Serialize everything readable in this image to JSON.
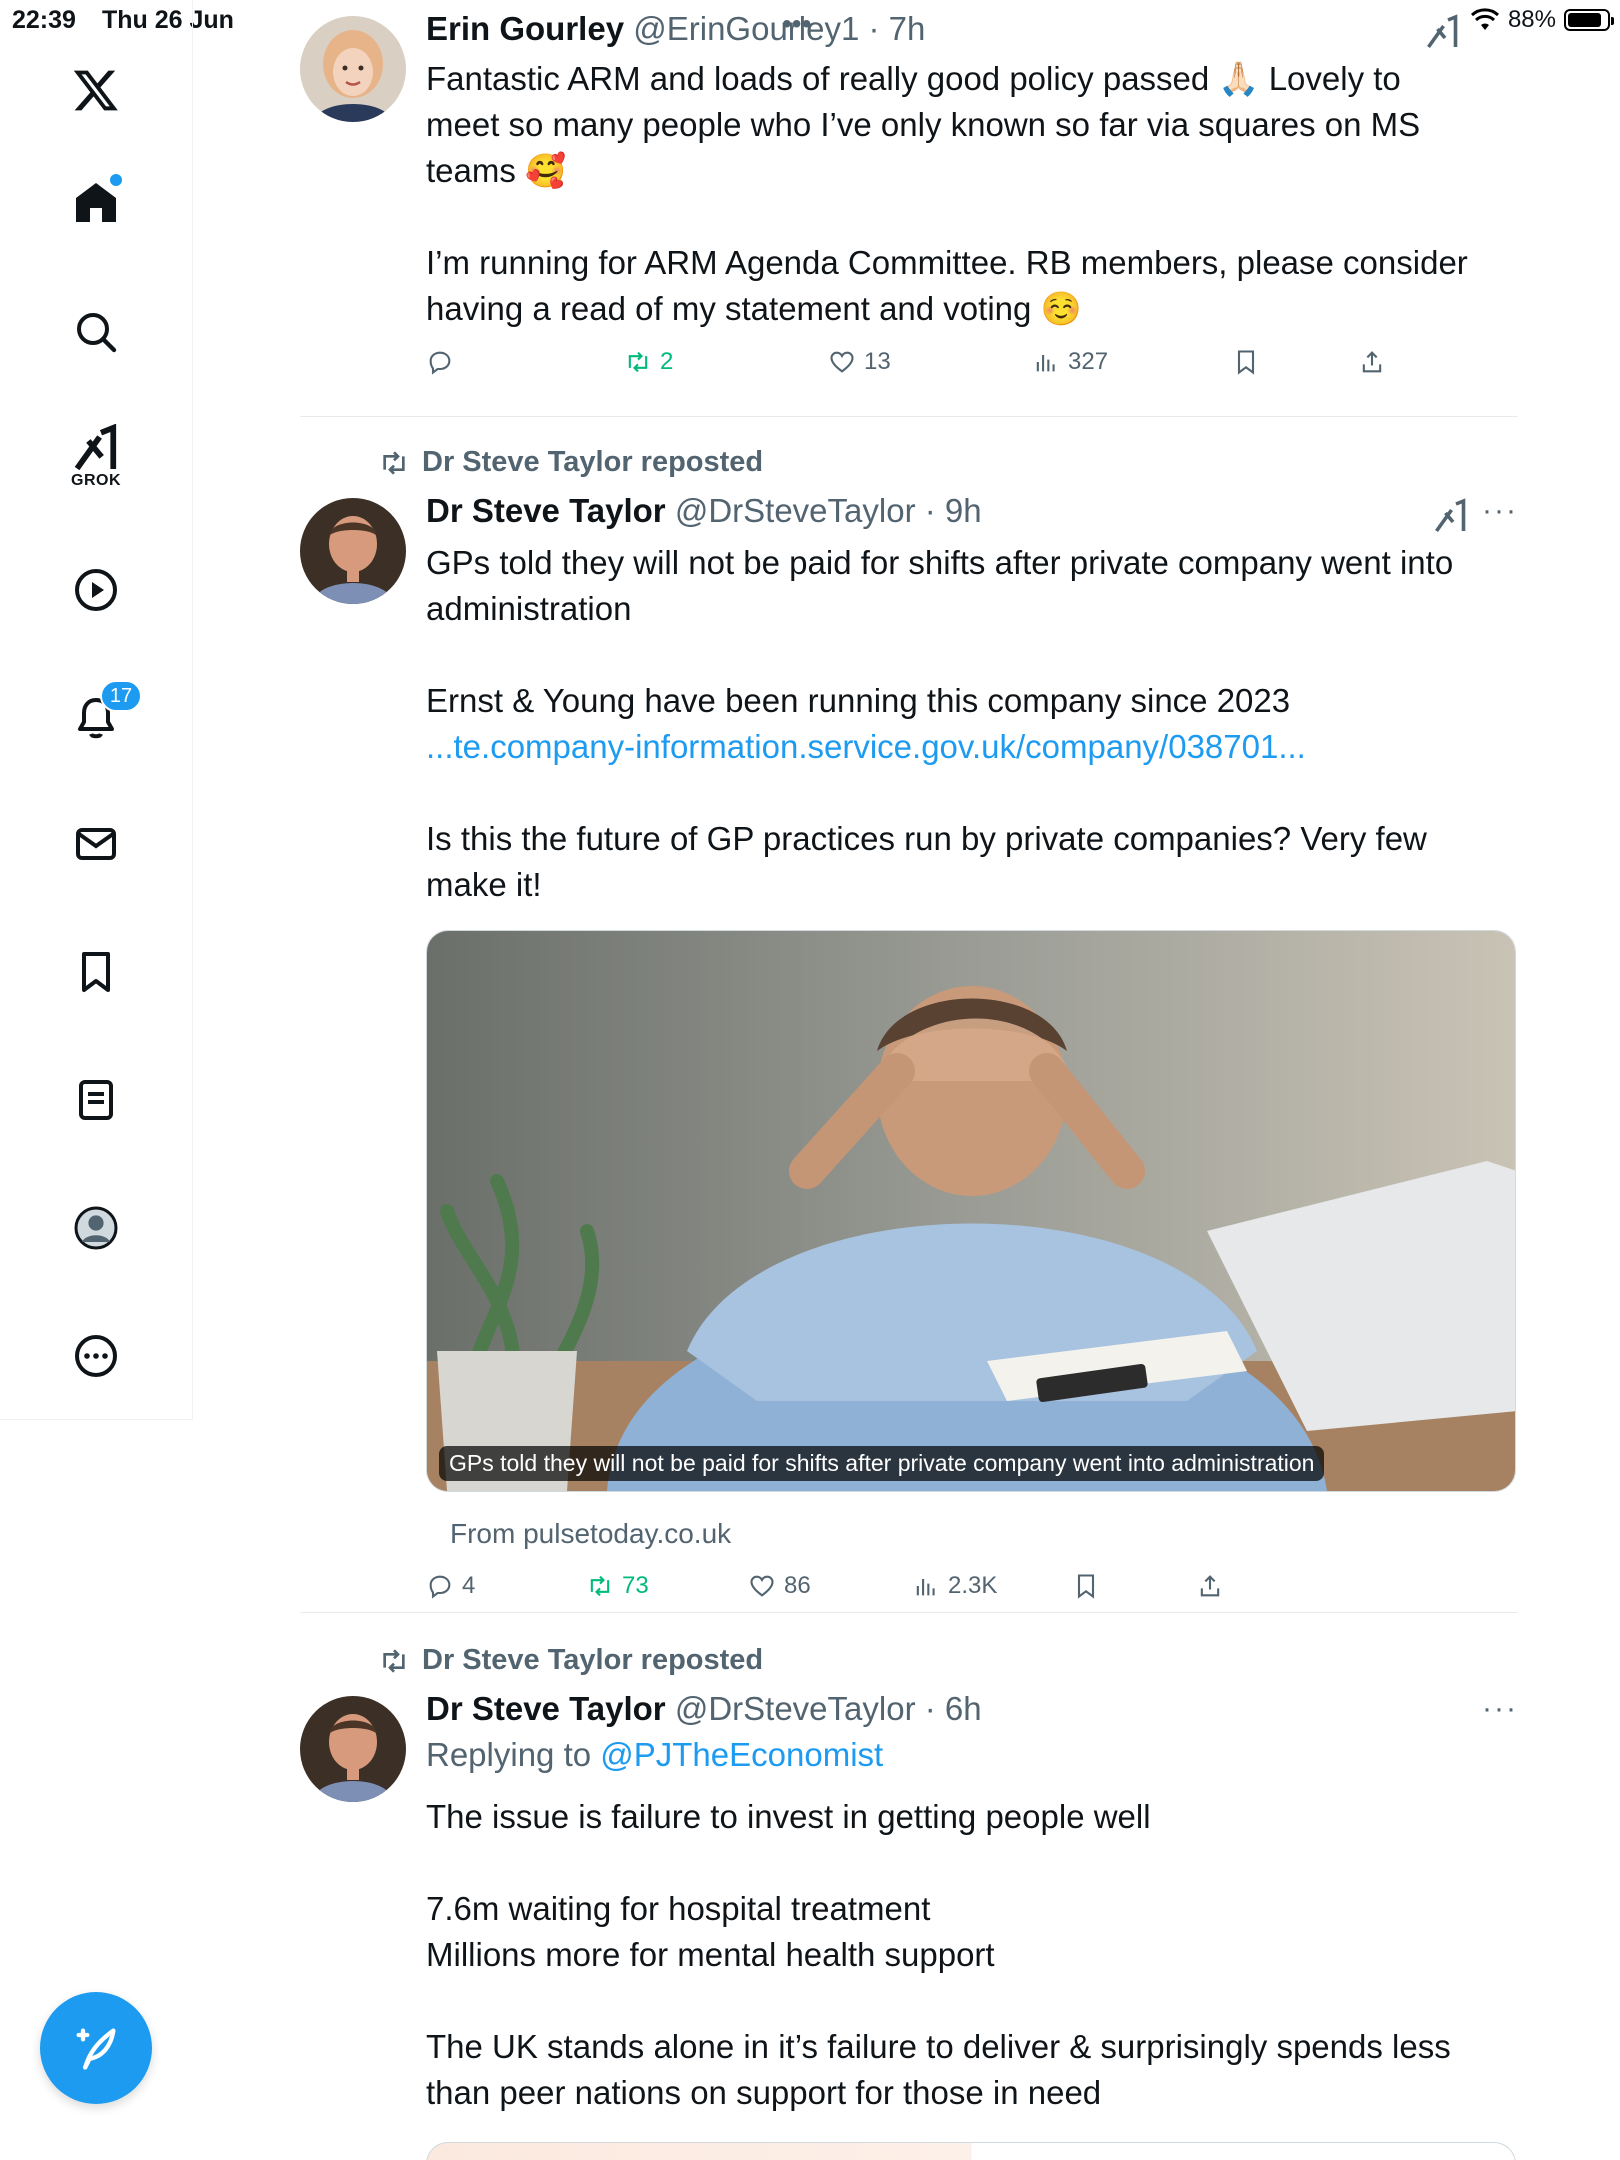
{
  "status_bar": {
    "time": "22:39",
    "date": "Thu 26 Jun",
    "battery": "88%",
    "battery_level": 0.88,
    "top_dots": "•••"
  },
  "sidebar": {
    "items": [
      {
        "name": "x-logo-icon"
      },
      {
        "name": "home-icon"
      },
      {
        "name": "search-icon"
      },
      {
        "name": "grok-icon",
        "label": "GROK"
      },
      {
        "name": "video-icon"
      },
      {
        "name": "notifications-icon",
        "badge": "17"
      },
      {
        "name": "messages-icon"
      },
      {
        "name": "bookmarks-icon"
      },
      {
        "name": "lists-icon"
      },
      {
        "name": "profile-icon"
      },
      {
        "name": "more-icon"
      }
    ],
    "compose_icon": "compose-icon"
  },
  "posts": [
    {
      "author": "Erin Gourley",
      "handle": "@ErinGourley1",
      "time": "· 7h",
      "body": [
        "Fantastic ARM and loads of really good policy passed 🙏🏻 Lovely to",
        "meet so many people who I’ve only known so far via squares on MS",
        "teams 🥰",
        "",
        "I’m running for ARM Agenda Committee. RB members, please consider",
        "having a read of my statement and voting ☺️"
      ],
      "actions": {
        "reply": "",
        "repost": "2",
        "like": "13",
        "views": "327"
      }
    },
    {
      "repost_label": "Dr Steve Taylor reposted",
      "author": "Dr Steve Taylor",
      "handle": "@DrSteveTaylor",
      "time": "· 9h",
      "more": "···",
      "body_lines": {
        "l1": "GPs told they will not be paid for shifts after private company went into",
        "l2": "administration",
        "l3": "Ernst & Young have been running this company since 2023",
        "link": "...te.company-information.service.gov.uk/company/038701...",
        "l4": "Is this the future of GP practices run by private companies? Very few",
        "l5": "make it!"
      },
      "media_caption": "GPs told they will not be paid for shifts after private company went into administration",
      "from": "From pulsetoday.co.uk",
      "actions": {
        "reply": "4",
        "repost": "73",
        "like": "86",
        "views": "2.3K"
      }
    },
    {
      "repost_label": "Dr Steve Taylor reposted",
      "author": "Dr Steve Taylor",
      "handle": "@DrSteveTaylor",
      "time": "· 6h",
      "more": "···",
      "replying_prefix": "Replying to ",
      "replying_to": "@PJTheEconomist",
      "body": [
        "The issue is failure to invest in getting people well",
        "",
        "7.6m waiting for hospital treatment",
        "Millions more for mental health support",
        "",
        "The UK stands alone in it’s failure to deliver & surprisingly spends less",
        "than peer nations on support for those in need"
      ]
    }
  ],
  "colors": {
    "accent": "#1d9bf0",
    "repost_green": "#00ba7c",
    "muted_text": "#536471",
    "text": "#0f1419"
  }
}
